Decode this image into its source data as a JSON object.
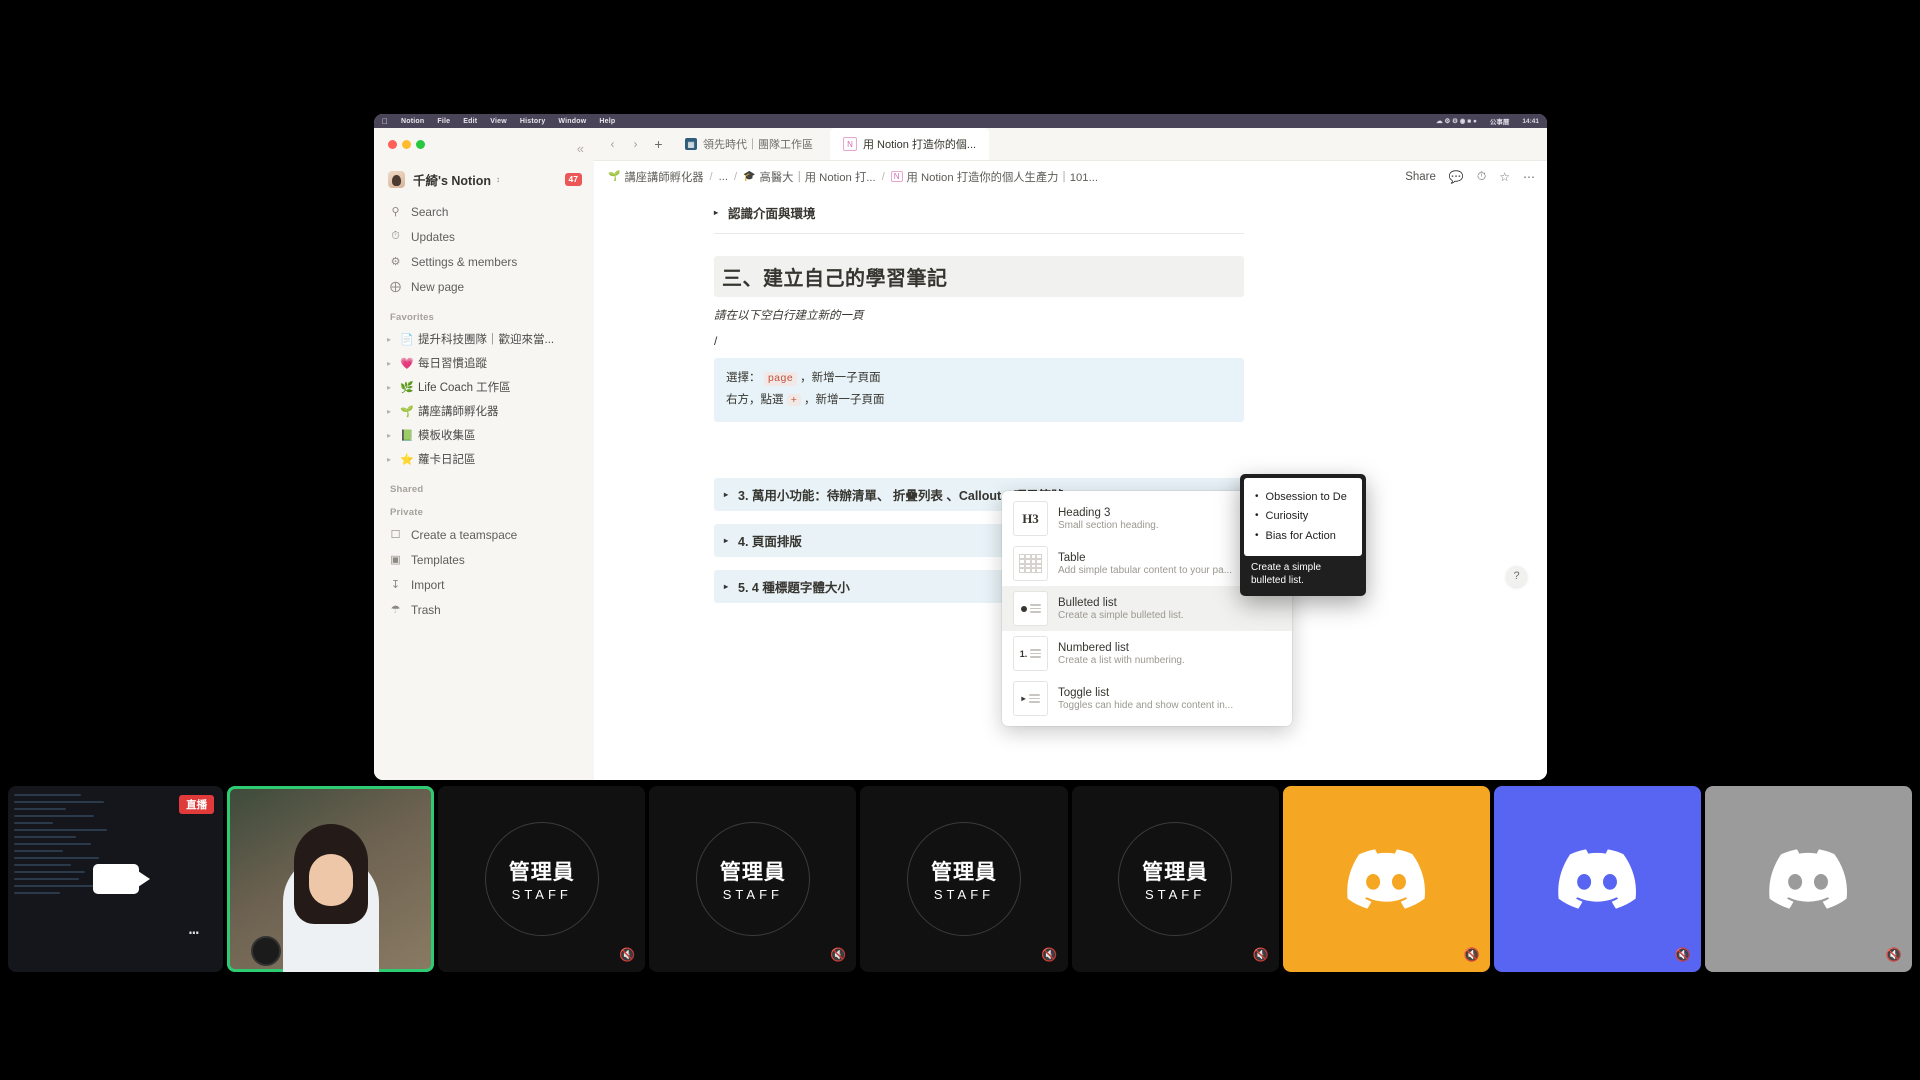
{
  "menubar": {
    "apple": "",
    "items": [
      "Notion",
      "File",
      "Edit",
      "View",
      "History",
      "Window",
      "Help"
    ],
    "right_items": [
      "公事曆",
      "14:41"
    ]
  },
  "sidebar": {
    "collapse_icon": "chevrons-left-icon",
    "workspace": {
      "name": "千綺's Notion",
      "badge": "47"
    },
    "items": [
      {
        "label": "Search",
        "icon": "search-icon"
      },
      {
        "label": "Updates",
        "icon": "clock-icon"
      },
      {
        "label": "Settings & members",
        "icon": "gear-icon"
      },
      {
        "label": "New page",
        "icon": "plus-circle-icon"
      }
    ],
    "favorites_heading": "Favorites",
    "favorites": [
      {
        "emoji": "📄",
        "label": "提升科技團隊｜歡迎來當..."
      },
      {
        "emoji": "💗",
        "label": "每日習慣追蹤"
      },
      {
        "emoji": "🌿",
        "label": "Life Coach 工作區"
      },
      {
        "emoji": "🌱",
        "label": "講座講師孵化器"
      },
      {
        "emoji": "📗",
        "label": "模板收集區"
      },
      {
        "emoji": "⭐",
        "label": "蘿卡日記區"
      }
    ],
    "shared_heading": "Shared",
    "private_heading": "Private",
    "private": [
      {
        "label": "Create a teamspace",
        "icon": "teamspace-icon"
      },
      {
        "label": "Templates",
        "icon": "template-icon"
      },
      {
        "label": "Import",
        "icon": "import-icon"
      },
      {
        "label": "Trash",
        "icon": "trash-icon"
      }
    ]
  },
  "tabbar": {
    "back_icon": "chevron-left-icon",
    "forward_icon": "chevron-right-icon",
    "new_tab_icon": "plus-icon",
    "tabs": [
      {
        "label": "領先時代｜團隊工作區",
        "icon": "workspace-icon",
        "active": false
      },
      {
        "label": "用 Notion 打造你的個...",
        "icon": "notion-icon",
        "active": true
      }
    ]
  },
  "breadcrumb": {
    "items": [
      {
        "emoji": "🌱",
        "label": "講座講師孵化器"
      },
      {
        "emoji": "",
        "label": "..."
      },
      {
        "emoji": "🎓",
        "label": "高醫大｜用 Notion 打..."
      },
      {
        "emoji": "N",
        "label": "用 Notion 打造你的個人生產力｜101..."
      }
    ],
    "actions": [
      {
        "label": "Share",
        "name": "share-button"
      },
      {
        "label": "",
        "name": "comment-icon"
      },
      {
        "label": "",
        "name": "history-icon"
      },
      {
        "label": "",
        "name": "favorite-star-icon"
      },
      {
        "label": "",
        "name": "more-options-icon"
      }
    ]
  },
  "document": {
    "clipped_toggle": "認識介面與環境",
    "heading": "三、建立自己的學習筆記",
    "subtitle": "請在以下空白行建立新的一頁",
    "slash_text": "/",
    "callout_line1_prefix": "選擇：",
    "callout_code": "page",
    "callout_line1_suffix": "，新增一子頁面",
    "callout_line2_prefix": "右方，點選",
    "callout_plus": "+",
    "callout_line2_suffix": "，新增一子頁面",
    "sections": [
      {
        "label": "3. 萬用小功能：待辦清單、 折疊列表 、Callout、項目符號"
      },
      {
        "label": "4. 頁面排版"
      },
      {
        "label": "5. 4 種標題字體大小"
      }
    ],
    "help_label": "?"
  },
  "slash_menu": {
    "items": [
      {
        "title": "Heading 3",
        "subtitle": "Small section heading.",
        "icon": "h3-icon",
        "selected": false
      },
      {
        "title": "Table",
        "subtitle": "Add simple tabular content to your pa...",
        "icon": "table-icon",
        "selected": false
      },
      {
        "title": "Bulleted list",
        "subtitle": "Create a simple bulleted list.",
        "icon": "bulleted-list-icon",
        "selected": true
      },
      {
        "title": "Numbered list",
        "subtitle": "Create a list with numbering.",
        "icon": "numbered-list-icon",
        "selected": false
      },
      {
        "title": "Toggle list",
        "subtitle": "Toggles can hide and show content in...",
        "icon": "toggle-list-icon",
        "selected": false
      }
    ]
  },
  "preview_tooltip": {
    "bullets": [
      "Obsession to De",
      "Curiosity",
      "Bias for Action"
    ],
    "caption": "Create a simple bulleted list."
  },
  "video_tiles": [
    {
      "type": "screen",
      "label": "",
      "badge": "直播",
      "muted": false,
      "selected": false,
      "name": "tile-screenshare"
    },
    {
      "type": "webcam",
      "label": "",
      "badge": "",
      "muted": false,
      "selected": true,
      "name": "tile-webcam-host"
    },
    {
      "type": "staff",
      "cn": "管理員",
      "en": "STAFF",
      "muted": true,
      "selected": false,
      "name": "tile-staff-1"
    },
    {
      "type": "staff",
      "cn": "管理員",
      "en": "STAFF",
      "muted": true,
      "selected": false,
      "name": "tile-staff-2"
    },
    {
      "type": "staff",
      "cn": "管理員",
      "en": "STAFF",
      "muted": true,
      "selected": false,
      "name": "tile-staff-3"
    },
    {
      "type": "staff",
      "cn": "管理員",
      "en": "STAFF",
      "muted": true,
      "selected": false,
      "name": "tile-staff-4"
    },
    {
      "type": "discord",
      "color": "#f5a623",
      "muted": true,
      "selected": false,
      "name": "tile-discord-1"
    },
    {
      "type": "discord",
      "color": "#5865f2",
      "muted": true,
      "selected": false,
      "name": "tile-discord-2"
    },
    {
      "type": "discord",
      "color": "#9b9b9b",
      "muted": true,
      "selected": false,
      "name": "tile-discord-3"
    }
  ],
  "colors": {
    "accent_red": "#eb5757",
    "sidebar_bg": "#f7f6f3",
    "callout_blue": "#e7f3f8",
    "section_blue": "#e8f2f7",
    "selected_green": "#2ecc71"
  }
}
